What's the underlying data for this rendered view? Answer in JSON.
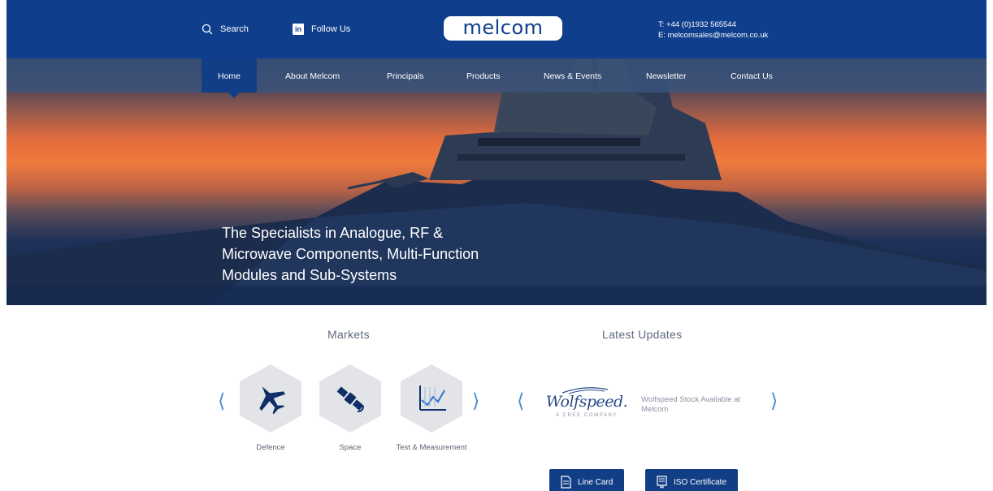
{
  "header": {
    "search_label": "Search",
    "follow_label": "Follow Us",
    "logo_text": "melcom",
    "phone": "T: +44 (0)1932 565544",
    "email": "E: melcomsales@melcom.co.uk"
  },
  "nav": {
    "items": [
      {
        "label": "Home"
      },
      {
        "label": "About Melcom"
      },
      {
        "label": "Principals"
      },
      {
        "label": "Products"
      },
      {
        "label": "News & Events"
      },
      {
        "label": "Newsletter"
      },
      {
        "label": "Contact Us"
      }
    ]
  },
  "hero": {
    "line1": "The Specialists in Analogue, RF &",
    "line2": "Microwave Components, Multi-Function",
    "line3": "Modules and Sub-Systems"
  },
  "markets": {
    "title": "Markets",
    "items": [
      {
        "label": "Defence",
        "icon": "fighter-jet-icon"
      },
      {
        "label": "Space",
        "icon": "satellite-icon"
      },
      {
        "label": "Test & Measurement",
        "icon": "chart-line-icon"
      }
    ],
    "prev_arrow": "⟨",
    "next_arrow": "⟩"
  },
  "updates": {
    "title": "Latest Updates",
    "brand": "Wolfspeed.",
    "brand_sub": "A CREE COMPANY",
    "text": "Wolfspeed Stock Available at Melcom",
    "prev_arrow": "⟨",
    "next_arrow": "⟩"
  },
  "buttons": {
    "line_card": "Line Card",
    "iso": "ISO Certificate"
  },
  "colors": {
    "brand_blue": "#0f3f8c",
    "nav_active": "#123e86",
    "arrow_blue": "#4a8ed8"
  }
}
